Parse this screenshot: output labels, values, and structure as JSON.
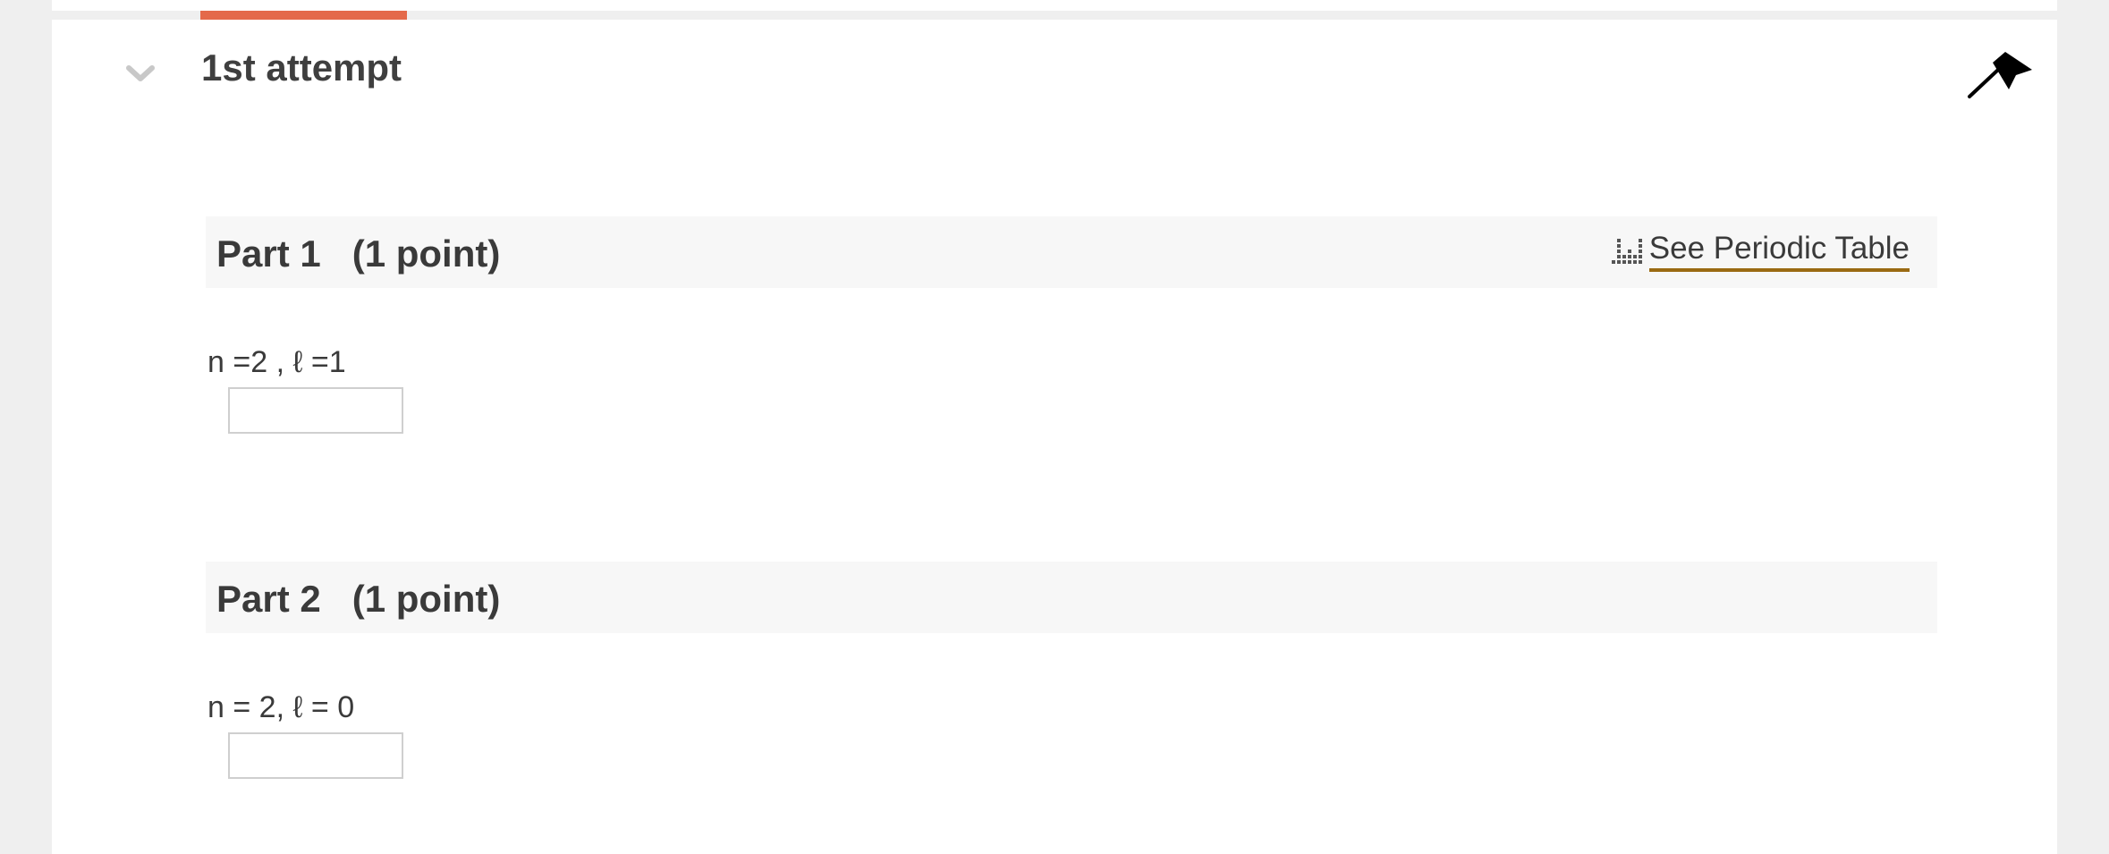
{
  "attempt": {
    "title": "1st attempt",
    "accent_color": "#e4694a"
  },
  "icons": {
    "collapse": "chevron-down-icon",
    "flag": "flag-icon",
    "periodic": "periodic-table-icon"
  },
  "parts": [
    {
      "title": "Part 1   (1 point)",
      "question": "n =2 , ℓ =1",
      "answer_value": "",
      "link": "See Periodic Table"
    },
    {
      "title": "Part 2   (1 point)",
      "question": "n = 2, ℓ = 0",
      "answer_value": ""
    }
  ],
  "link_underline_color": "#9a6a12"
}
